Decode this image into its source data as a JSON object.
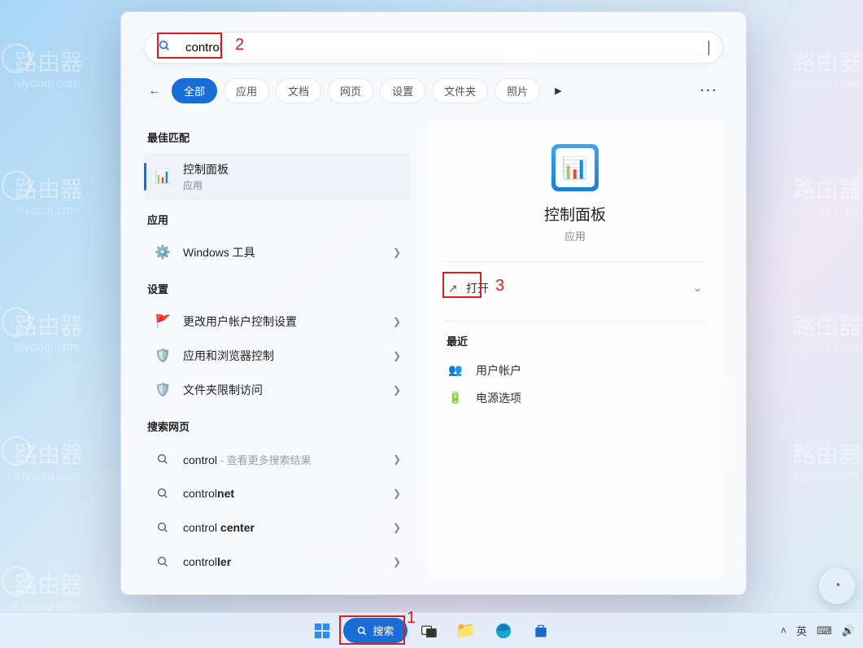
{
  "watermark": {
    "brand": "路由器",
    "domain": "luyouqi.com"
  },
  "search": {
    "value": "control"
  },
  "filters": {
    "items": [
      "全部",
      "应用",
      "文档",
      "网页",
      "设置",
      "文件夹",
      "照片"
    ],
    "active": 0,
    "more_label": "…"
  },
  "sections": {
    "best_match": "最佳匹配",
    "apps": "应用",
    "settings": "设置",
    "web": "搜索网页",
    "recent": "最近"
  },
  "best_match": {
    "title": "控制面板",
    "subtitle": "应用"
  },
  "apps_results": [
    {
      "label": "Windows 工具"
    }
  ],
  "settings_results": [
    {
      "label": "更改用户帐户控制设置",
      "icon": "flag"
    },
    {
      "label": "应用和浏览器控制",
      "icon": "shield"
    },
    {
      "label": "文件夹限制访问",
      "icon": "shield"
    }
  ],
  "web_results": [
    {
      "prefix": "control",
      "bold": "",
      "hint": " - 查看更多搜索结果"
    },
    {
      "prefix": "control",
      "bold": "net",
      "hint": ""
    },
    {
      "prefix": "control ",
      "bold": "center",
      "hint": ""
    },
    {
      "prefix": "control",
      "bold": "ler",
      "hint": ""
    }
  ],
  "detail": {
    "title": "控制面板",
    "type": "应用",
    "open_label": "打开",
    "recent": [
      {
        "label": "用户帐户",
        "icon": "👥"
      },
      {
        "label": "电源选项",
        "icon": "🔋"
      }
    ]
  },
  "taskbar": {
    "search_label": "搜索",
    "ime_eng": "英",
    "ime_toggle": "⌨"
  },
  "annotations": {
    "n1": "1",
    "n2": "2",
    "n3": "3"
  }
}
